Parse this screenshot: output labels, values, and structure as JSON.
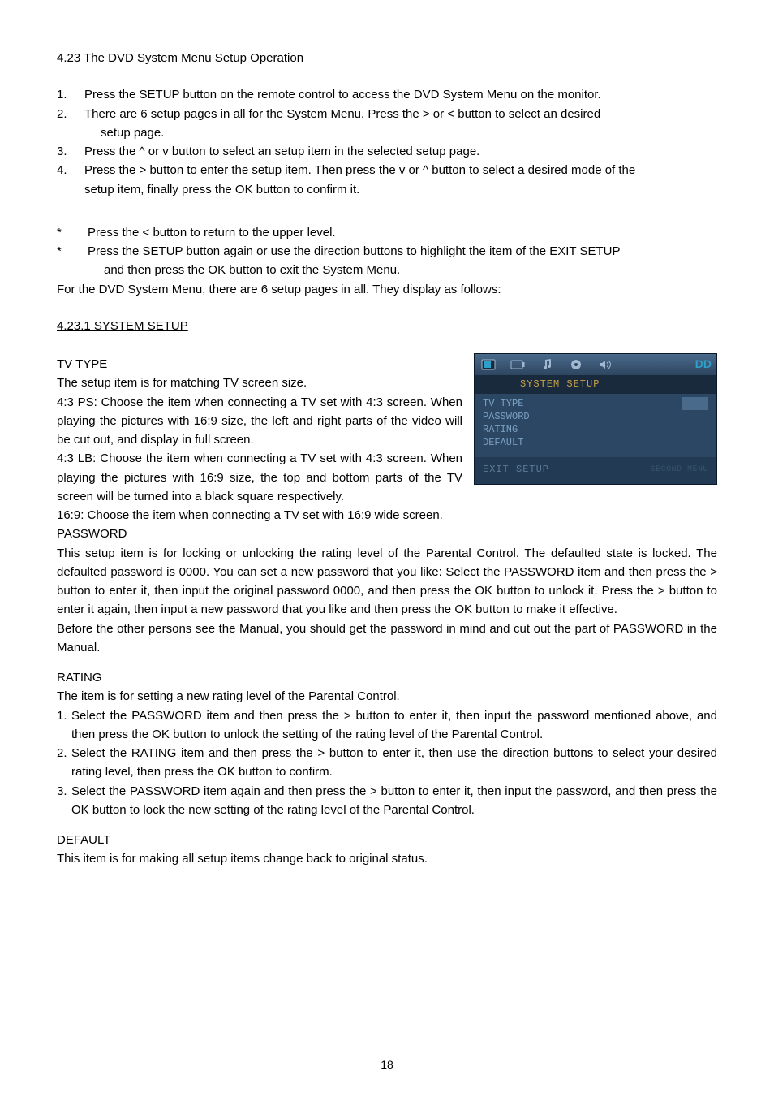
{
  "heading_main": "4.23 The DVD System Menu Setup Operation",
  "ol1": {
    "n1": "1.",
    "t1": "Press the SETUP button on the remote control to access the DVD System Menu on the monitor.",
    "n2": "2.",
    "t2a": "There are 6 setup pages in all for the System Menu. Press the > or < button to select an desired",
    "t2b": "setup page.",
    "n3": "3.",
    "t3": "Press the ^ or v button to select an setup item in the selected setup page.",
    "n4": "4.",
    "t4a": "Press the > button to enter the setup item. Then press the v or ^ button to select a desired mode of the",
    "t4b": "setup item, finally press the OK button to confirm it."
  },
  "star1": {
    "s": "*",
    "t": "Press the < button to return to the upper level."
  },
  "star2": {
    "s": "*",
    "t1": "Press the SETUP button again or use the direction buttons to highlight the item of the EXIT SETUP",
    "t2": "and then press the OK button to exit the System Menu."
  },
  "para_follow": "For the DVD System Menu, there are 6 setup pages in all. They display as follows:",
  "subhead_4231": "4.23.1   SYSTEM SETUP ",
  "tv_type": {
    "title": "TV TYPE",
    "intro": "The setup item is for matching TV screen size.",
    "l1": "4:3 PS: Choose the item when connecting a TV set with 4:3 screen. When playing the pictures with 16:9 size, the left and right parts of the video will be cut out, and display in full screen.",
    "l2": "4:3 LB: Choose the item when connecting a TV set with 4:3 screen. When playing the pictures with 16:9 size, the top and bottom parts of the TV screen will be turned into a black square respectively.",
    "l3": "16:9: Choose the item when connecting a TV set with 16:9 wide screen."
  },
  "password": {
    "title": "PASSWORD",
    "body1": "This setup item is for locking or unlocking the rating level of the Parental Control. The defaulted state is locked. The defaulted password is 0000. You can set a new password that you like: Select the PASSWORD item and then press the > button to enter it, then input the original password 0000, and then press the OK button to unlock it. Press the > button to enter it again, then input a new password that you like and then press the OK button to make it effective.",
    "body2": "Before the other persons see the Manual, you should get the password in mind and cut out the part of PASSWORD in the Manual."
  },
  "rating": {
    "title": "RATING",
    "intro": "The item is for setting a new rating level of the Parental Control.",
    "n1": "1.",
    "t1": "Select the PASSWORD item and then press the > button to enter it, then input the password mentioned above, and then press the OK button to unlock the setting of the rating level of the Parental Control.",
    "n2": "2.",
    "t2": "Select the RATING item and then press the > button to enter it, then use the direction buttons to select your desired rating level, then press the OK button to confirm.",
    "n3": "3.",
    "t3": "Select the PASSWORD item again and then press the > button to enter it, then input the password, and then press the OK button to lock the new setting of the rating level of the Parental Control."
  },
  "default": {
    "title": "DEFAULT",
    "body": "This item is for making all setup items change back to original status."
  },
  "page_number": "18",
  "sysmenu": {
    "dd": "DD",
    "title": "SYSTEM SETUP",
    "items": [
      "TV TYPE",
      "PASSWORD",
      "RATING",
      "DEFAULT"
    ],
    "exit": "EXIT SETUP",
    "hint": "SECOND MENU"
  }
}
